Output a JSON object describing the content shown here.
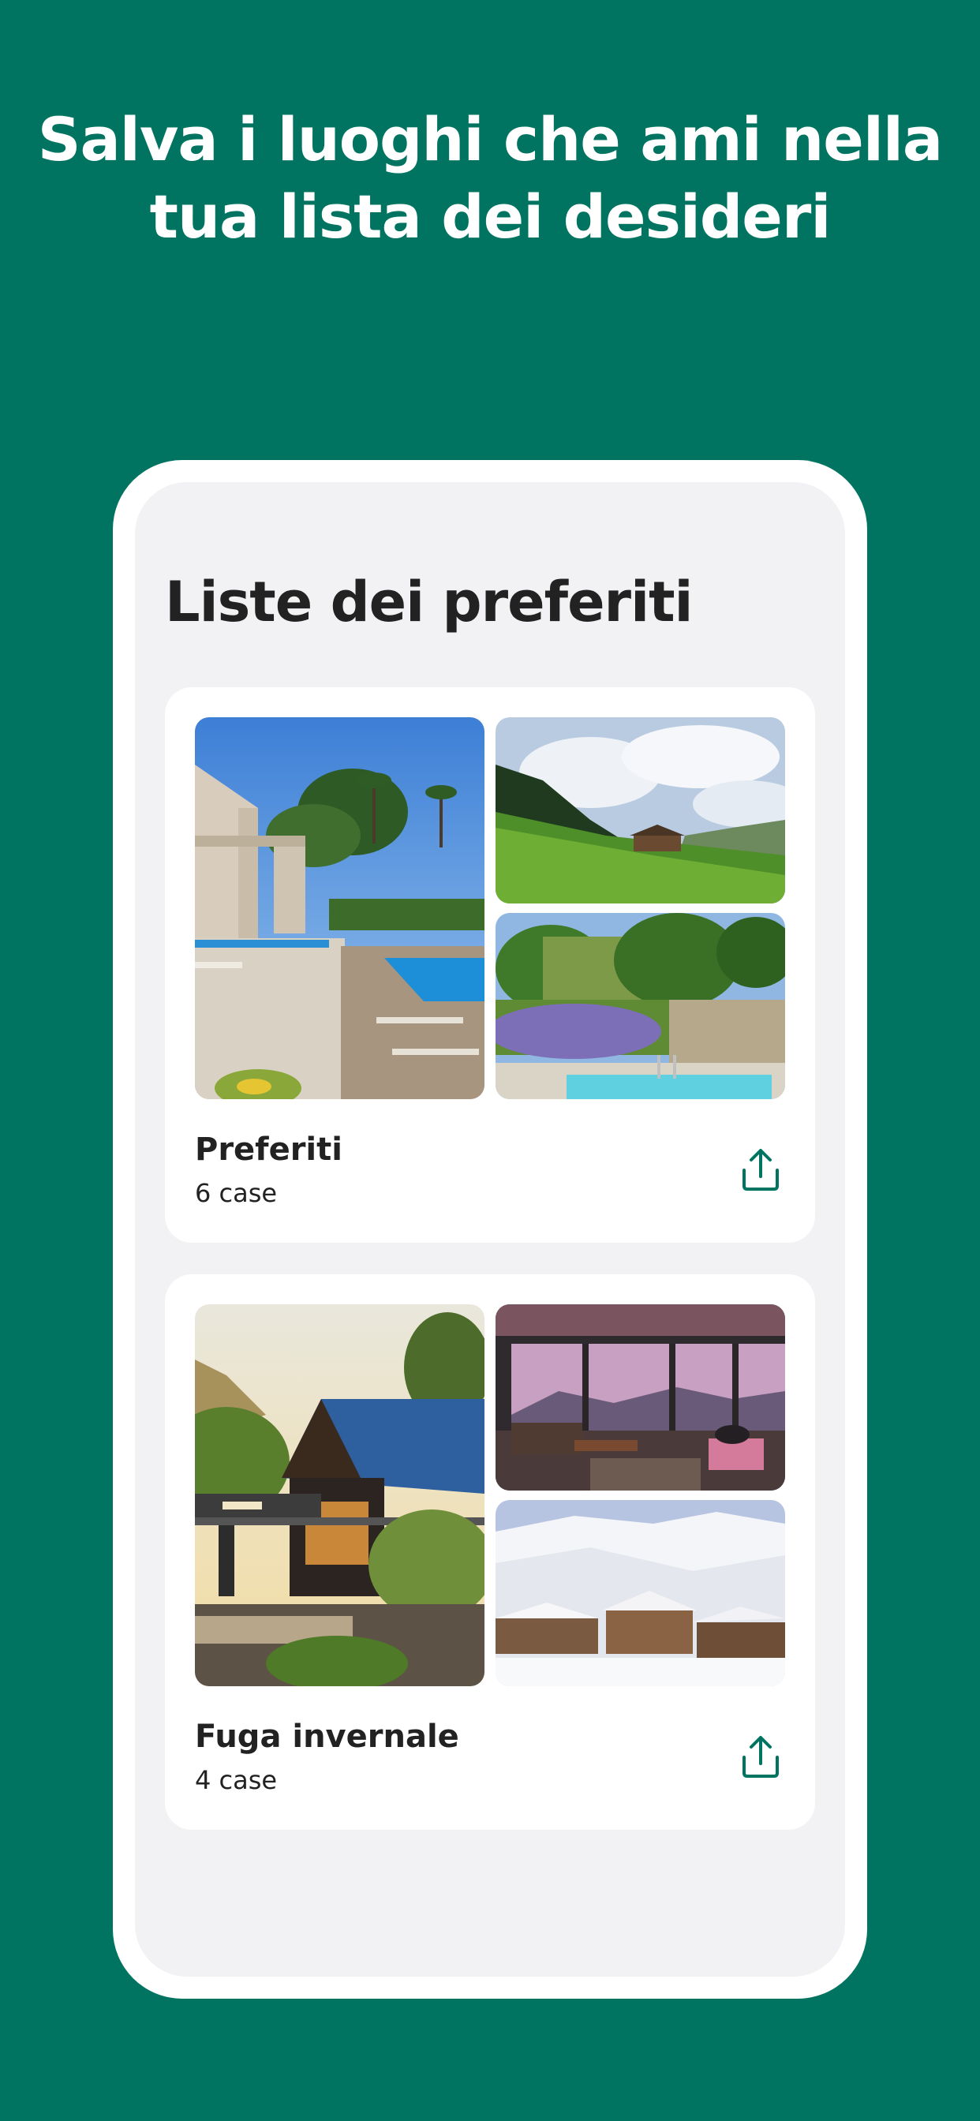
{
  "headline": {
    "line1": "Salva i luoghi che ami nella",
    "line2": "tua lista dei desideri"
  },
  "screen": {
    "title": "Liste dei preferiti"
  },
  "wishlists": [
    {
      "name": "Preferiti",
      "count": "6 case",
      "photos": [
        "villa-pool-photo",
        "alpine-meadow-chalet-photo",
        "ivy-covered-house-pool-photo"
      ]
    },
    {
      "name": "Fuga invernale",
      "count": "4 case",
      "photos": [
        "blue-roof-cabin-photo",
        "panoramic-living-room-photo",
        "snowy-chalets-photo"
      ]
    }
  ],
  "icons": {
    "share": "share-icon"
  },
  "colors": {
    "background": "#007460",
    "accent": "#007460",
    "screen": "#f2f2f4",
    "card": "#ffffff",
    "text": "#222222"
  }
}
